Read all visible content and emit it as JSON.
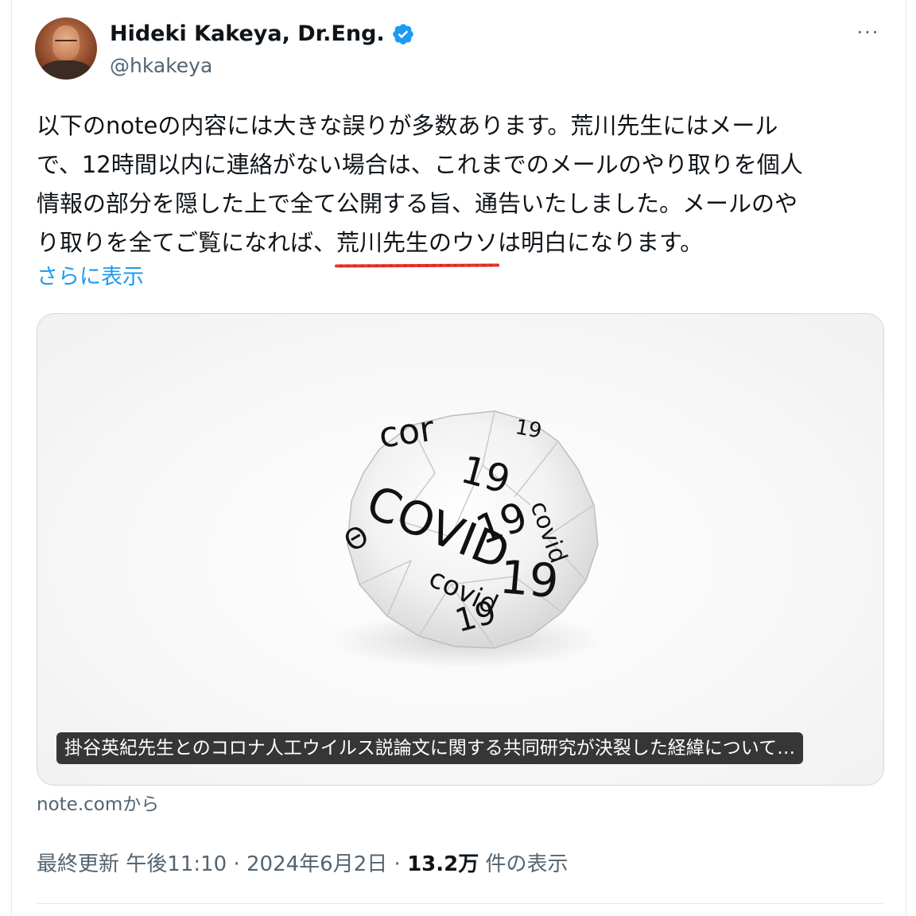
{
  "author": {
    "display_name": "Hideki Kakeya, Dr.Eng.",
    "handle": "@hkakeya",
    "verified_icon": "verified-badge-icon",
    "verified_color": "#1d9bf0"
  },
  "more_menu": "···",
  "tweet": {
    "line1": "以下のnoteの内容には大きな誤りが多数あります。荒川先生にはメール",
    "line2": "で、12時間以内に連絡がない場合は、これまでのメールのやり取りを個人",
    "line3": "情報の部分を隠した上で全て公開する旨、通告いたしました。メールのや",
    "line4_before": "り取りを全てご覧になれば、",
    "line4_underlined": "荒川先生のウソ",
    "line4_after": "は明白になります。",
    "show_more": "さらに表示"
  },
  "card": {
    "caption": "掛谷英紀先生とのコロナ人工ウイルス説論文に関する共同研究が決裂した経緯について…",
    "image_text": [
      "COVID",
      "19",
      "Covid",
      "19",
      "19",
      "covid",
      "19"
    ]
  },
  "source": "note.comから",
  "meta": {
    "updated_label": "最終更新",
    "time": "午後11:10",
    "separator": "·",
    "date": "2024年6月2日",
    "views_count": "13.2万",
    "views_label": "件の表示"
  },
  "colors": {
    "link": "#1d9bf0",
    "secondary_text": "#536471",
    "underline": "#e8352e"
  }
}
